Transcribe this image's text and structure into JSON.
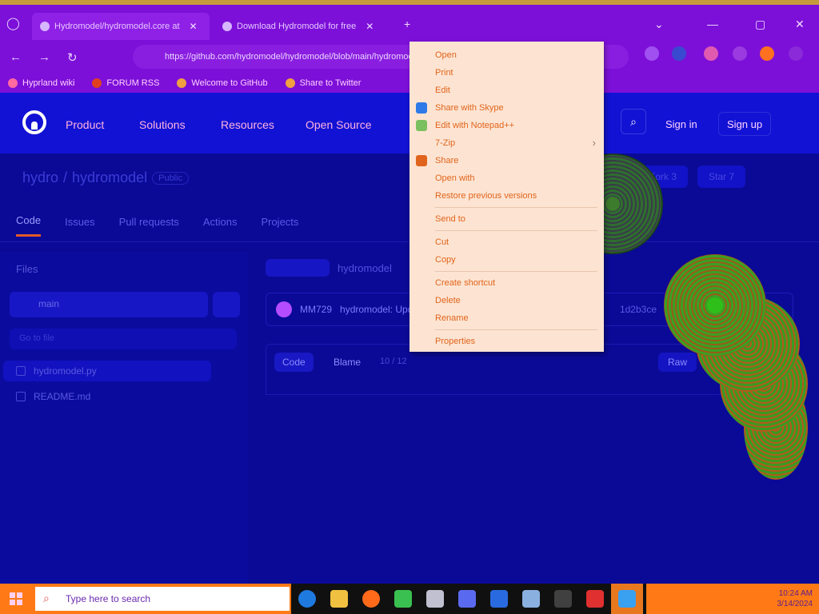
{
  "browser": {
    "tabs": [
      {
        "title": "Hydromodel/hydromodel.core at",
        "active": true
      },
      {
        "title": "Download Hydromodel for free",
        "active": false
      }
    ],
    "address": "https://github.com/hydromodel/hydromodel/blob/main/hydromodel.py",
    "bookmarks": [
      "Hyprland wiki",
      "FORUM RSS",
      "Welcome to GitHub",
      "Share to Twitter"
    ]
  },
  "github": {
    "nav": [
      "Product",
      "Solutions",
      "Resources",
      "Open Source"
    ],
    "sign_in": "Sign in",
    "sign_up": "Sign up"
  },
  "repo": {
    "owner": "hydro",
    "name": "hydromodel",
    "visibility": "Public",
    "actions": [
      "Fork 3",
      "Star 7"
    ],
    "tabs": [
      "Code",
      "Issues",
      "Pull requests",
      "Actions",
      "Projects"
    ],
    "files_title": "Files",
    "branch": "main",
    "filter_placeholder": "Go to file",
    "file_items": [
      "hydromodel.py",
      "README.md"
    ],
    "breadcrumb": "hydromodel",
    "commit_user": "MM729",
    "commit_msg": "hydromodel: Update",
    "commit_hash": "1d2b3ce",
    "code_tabs": [
      "Code",
      "Blame"
    ],
    "code_meta": "10 / 12",
    "raw_label": "Raw"
  },
  "context_menu": {
    "groups": [
      [
        {
          "label": "Open",
          "icon": "none"
        },
        {
          "label": "Print",
          "icon": "none"
        },
        {
          "label": "Edit",
          "icon": "none"
        },
        {
          "label": "Share with Skype",
          "icon": "skype-icon"
        },
        {
          "label": "Edit with Notepad++",
          "icon": "notepad-icon"
        },
        {
          "label": "7-Zip",
          "icon": "none",
          "submenu": true
        },
        {
          "label": "Share",
          "icon": "share-icon"
        },
        {
          "label": "Open with",
          "icon": "none"
        },
        {
          "label": "Restore previous versions",
          "icon": "none"
        }
      ],
      [
        {
          "label": "Send to",
          "icon": "none"
        }
      ],
      [
        {
          "label": "Cut",
          "icon": "none"
        },
        {
          "label": "Copy",
          "icon": "none"
        }
      ],
      [
        {
          "label": "Create shortcut",
          "icon": "none"
        },
        {
          "label": "Delete",
          "icon": "none"
        },
        {
          "label": "Rename",
          "icon": "none"
        }
      ],
      [
        {
          "label": "Properties",
          "icon": "none"
        }
      ]
    ]
  },
  "taskbar": {
    "search_text": "Type here to search",
    "apps": [
      "edge-icon",
      "file-explorer-icon",
      "firefox-icon",
      "people-icon",
      "photos-icon",
      "discord-icon",
      "app-icon",
      "notepad-icon",
      "terminal-icon",
      "tools-icon",
      "photos-app-icon"
    ],
    "tray_time": "10:24 AM",
    "tray_date": "3/14/2024"
  },
  "colors": {
    "background": "#0a0a96",
    "chrome": "#7c10d8",
    "menu": "#fde4d2",
    "menu_text": "#e0641c",
    "taskbar": "#ff7a16"
  }
}
